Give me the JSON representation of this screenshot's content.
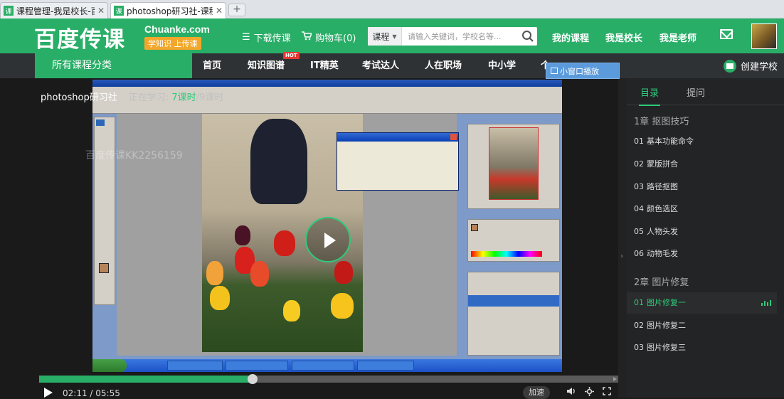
{
  "browser": {
    "tabs": [
      {
        "icon": "课",
        "title": "课程管理-我是校长-百度",
        "active": false
      },
      {
        "icon": "课",
        "title": "photoshop研习社-课程",
        "active": true
      }
    ],
    "new_tab": "+"
  },
  "header": {
    "logo_cn": "百度传课",
    "logo_en": "Chuanke.com",
    "slogan": "学知识 上传课",
    "download": "下载传课",
    "cart": "购物车(0)",
    "search": {
      "category": "课程",
      "placeholder": "请输入关键词，学校名等..."
    },
    "my_courses": "我的课程",
    "principal": "我是校长",
    "teacher": "我是老师"
  },
  "nav": {
    "all_categories": "所有课程分类",
    "items": [
      "首页",
      "知识图谱",
      "IT精英",
      "考试达人",
      "人在职场",
      "中小学",
      "个"
    ],
    "hot_badge": "HOT",
    "create_school": "创建学校"
  },
  "mini_window": "小窗口播放",
  "player": {
    "course_title": "photoshop研习社",
    "learning_label": "正在学习:",
    "current_lesson": "7课时",
    "total_lessons": "/9课时",
    "watermark": "百度传课KK2256159",
    "time": "02:11 / 05:55",
    "progress": 0.369,
    "speed": "加速"
  },
  "sidebar": {
    "tabs": [
      "目录",
      "提问"
    ],
    "chapters": [
      {
        "title": "1章 抠图技巧",
        "lessons": [
          {
            "num": "01",
            "title": "基本功能命令"
          },
          {
            "num": "02",
            "title": "蒙版拼合"
          },
          {
            "num": "03",
            "title": "路径抠图"
          },
          {
            "num": "04",
            "title": "颜色选区"
          },
          {
            "num": "05",
            "title": "人物头发"
          },
          {
            "num": "06",
            "title": "动物毛发"
          }
        ]
      },
      {
        "title": "2章 图片修复",
        "lessons": [
          {
            "num": "01",
            "title": "图片修复一",
            "active": true
          },
          {
            "num": "02",
            "title": "图片修复二"
          },
          {
            "num": "03",
            "title": "图片修复三"
          }
        ]
      }
    ]
  },
  "colors": {
    "brand_green": "#29ae67",
    "accent_green": "#2ecb7a",
    "dark_nav": "#2f3235",
    "mini_blue": "#5b9bdc"
  }
}
